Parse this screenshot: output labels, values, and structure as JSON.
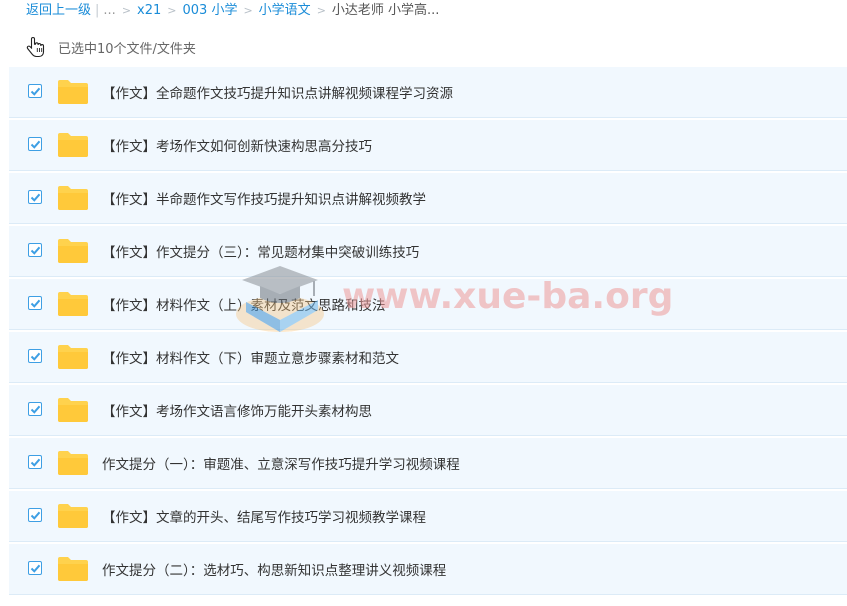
{
  "breadcrumb": {
    "back": "返回上一级",
    "ellipsis": "...",
    "items": [
      "x21",
      "003 小学",
      "小学语文"
    ],
    "current": "小达老师 小学高..."
  },
  "selection": {
    "status": "已选中10个文件/文件夹"
  },
  "files": [
    {
      "name": "【作文】全命题作文技巧提升知识点讲解视频课程学习资源",
      "checked": true
    },
    {
      "name": "【作文】考场作文如何创新快速构思高分技巧",
      "checked": true
    },
    {
      "name": "【作文】半命题作文写作技巧提升知识点讲解视频教学",
      "checked": true
    },
    {
      "name": "【作文】作文提分（三）：常见题材集中突破训练技巧",
      "checked": true
    },
    {
      "name": "【作文】材料作文（上）素材及范文思路和技法",
      "checked": true
    },
    {
      "name": "【作文】材料作文（下）审题立意步骤素材和范文",
      "checked": true
    },
    {
      "name": "【作文】考场作文语言修饰万能开头素材构思",
      "checked": true
    },
    {
      "name": "作文提分（一）：审题准、立意深写作技巧提升学习视频课程",
      "checked": true
    },
    {
      "name": "【作文】文章的开头、结尾写作技巧学习视频教学课程",
      "checked": true
    },
    {
      "name": "作文提分（二）：选材巧、构思新知识点整理讲义视频课程",
      "checked": true
    }
  ],
  "watermark": {
    "text": "www.xue-ba.org"
  },
  "colors": {
    "accent": "#1a8cd8",
    "row_bg": "#f1f8fe",
    "folder": "#ffd24d",
    "check": "#3e9fe4"
  }
}
